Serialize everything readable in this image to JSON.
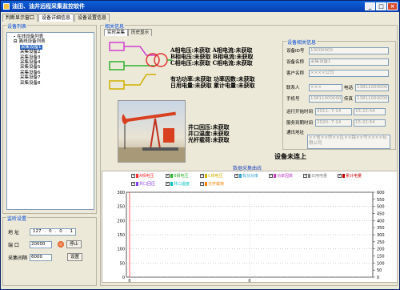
{
  "app": {
    "title": "油田、油井远程采集监控软件"
  },
  "window_buttons": [
    "_",
    "□",
    "×"
  ],
  "main_tabs": [
    "判断显示窗口",
    "设备详细信息",
    "设备设置信息"
  ],
  "left": {
    "device_list_title": "设备列表",
    "tree": [
      {
        "label": "在线设备列表",
        "level": 1,
        "prefix": "-"
      },
      {
        "label": "离线设备列表",
        "level": 1,
        "prefix": "⊟"
      },
      {
        "label": "采集设备1",
        "level": 2,
        "selected": true
      },
      {
        "label": "采集设备2",
        "level": 2
      },
      {
        "label": "采集设备3",
        "level": 2
      },
      {
        "label": "采集设备4",
        "level": 2
      },
      {
        "label": "采集设备5",
        "level": 2
      },
      {
        "label": "采集设备6",
        "level": 2
      },
      {
        "label": "采集设备7",
        "level": 2
      },
      {
        "label": "采集设备8",
        "level": 2
      }
    ],
    "listen_title": "监听设置",
    "address_label": "地    址",
    "ip": [
      "127",
      "0",
      "0",
      "1"
    ],
    "port_label": "端    口",
    "port_value": "20000",
    "stop_button": "停止",
    "interval_label": "采集间隔",
    "interval_value": "6000",
    "set_button": "设置"
  },
  "right": {
    "panel_title": "相关信息",
    "sub_tabs": [
      "实时采集",
      "历史显示"
    ],
    "values_block1": [
      "A相电压:未获取  A相电流:未获取",
      "B相电压:未获取  B相电流:未获取",
      "C相电压:未获取  C相电流:未获取"
    ],
    "values_block2": [
      "有功功率:未获取  功率因数:未获取",
      "日用电量:未获取  累计电量:未获取"
    ],
    "values_block3": [
      "井口回压:未获取",
      "井口温度:未获取",
      "光杆载荷:未获取"
    ],
    "device_info": {
      "title": "设备相关信息",
      "id_label": "设备ID号",
      "id_value": "10000000",
      "name_label": "设备名称",
      "name_value": "采集设备1",
      "customer_label": "客户名称",
      "customer_value": "××××公司",
      "contact_label": "联系人",
      "contact_value": "×××",
      "phone_label": "电话",
      "phone_value": "13811000000",
      "mobile_label": "手机号",
      "mobile_value": "13811000000",
      "fax_label": "传真",
      "fax_value": "13811000000",
      "start_label": "运行开始时间",
      "start_date": "2011- 7-14",
      "start_time": "15:22:54",
      "service_label": "服务到期时间",
      "service_date": "2020- 7-14",
      "service_time": "15:22:54",
      "address_label": "通讯地址",
      "address_value": "××省××市××区××路××号××××有限公司"
    },
    "status": "设备未连上",
    "chart": {
      "title": "数据采集曲线",
      "legend": [
        {
          "label": "A相电压",
          "color": "#ff3030"
        },
        {
          "label": "B相电压",
          "color": "#30b030"
        },
        {
          "label": "C相电压",
          "color": "#d0b000"
        },
        {
          "label": "有功功率",
          "color": "#30a0d0"
        },
        {
          "label": "功率因数",
          "color": "#c040c0"
        },
        {
          "label": "日用电量",
          "color": "#808080"
        },
        {
          "label": "累计电量",
          "color": "#c00000"
        },
        {
          "label": "井口回压",
          "color": "#8040ff"
        },
        {
          "label": "井口温度",
          "color": "#00c0c0"
        },
        {
          "label": "光杆载荷",
          "color": "#ff8000"
        }
      ],
      "y_left_ticks": [
        "300",
        "250",
        "200",
        "150",
        "100",
        "50",
        "0"
      ],
      "y_right_ticks": [
        "600",
        "550",
        "500",
        "450",
        "400",
        "350",
        "300",
        "250",
        "200",
        "150",
        "100",
        "50",
        "0"
      ],
      "x_ticks": [
        "0",
        "0"
      ]
    }
  }
}
